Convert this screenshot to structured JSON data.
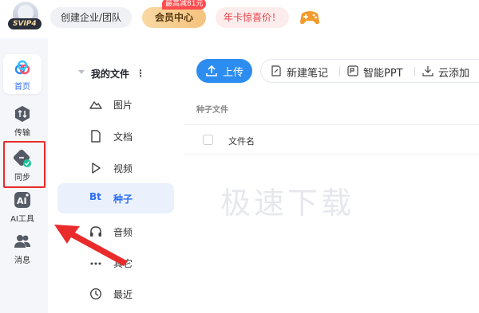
{
  "topbar": {
    "svip_label": "SVIP4",
    "team_button": "创建企业/团队",
    "vip_center": "会员中心",
    "vip_badge": "最高减81元",
    "year_card": "年卡惊喜价！",
    "game_icon": "gamepad-icon"
  },
  "rail": {
    "items": [
      {
        "label": "首页",
        "icon": "cloud-logo-icon"
      },
      {
        "label": "传输",
        "icon": "transfer-icon"
      },
      {
        "label": "同步",
        "icon": "sync-icon"
      },
      {
        "label": "AI工具",
        "icon": "ai-tool-icon"
      },
      {
        "label": "消息",
        "icon": "people-icon"
      }
    ]
  },
  "categories": {
    "header": "我的文件",
    "items": [
      {
        "label": "图片",
        "icon": "mountain-icon"
      },
      {
        "label": "文档",
        "icon": "document-icon"
      },
      {
        "label": "视频",
        "icon": "play-icon"
      },
      {
        "label": "种子",
        "icon": "bt-icon",
        "active": true
      },
      {
        "label": "音频",
        "icon": "headphones-icon"
      },
      {
        "label": "其它",
        "icon": "more-dots-icon"
      },
      {
        "label": "最近",
        "icon": "clock-icon"
      }
    ]
  },
  "main": {
    "upload": "上传",
    "tools": {
      "note": "新建笔记",
      "ppt": "智能PPT",
      "cloud_add": "云添加"
    },
    "path": "种子文件",
    "column_name": "文件名",
    "watermark": "极速下载"
  },
  "colors": {
    "accent": "#2d6df6",
    "upload_button": "#2d8cf0",
    "annotation_red": "#ea2b2b"
  }
}
